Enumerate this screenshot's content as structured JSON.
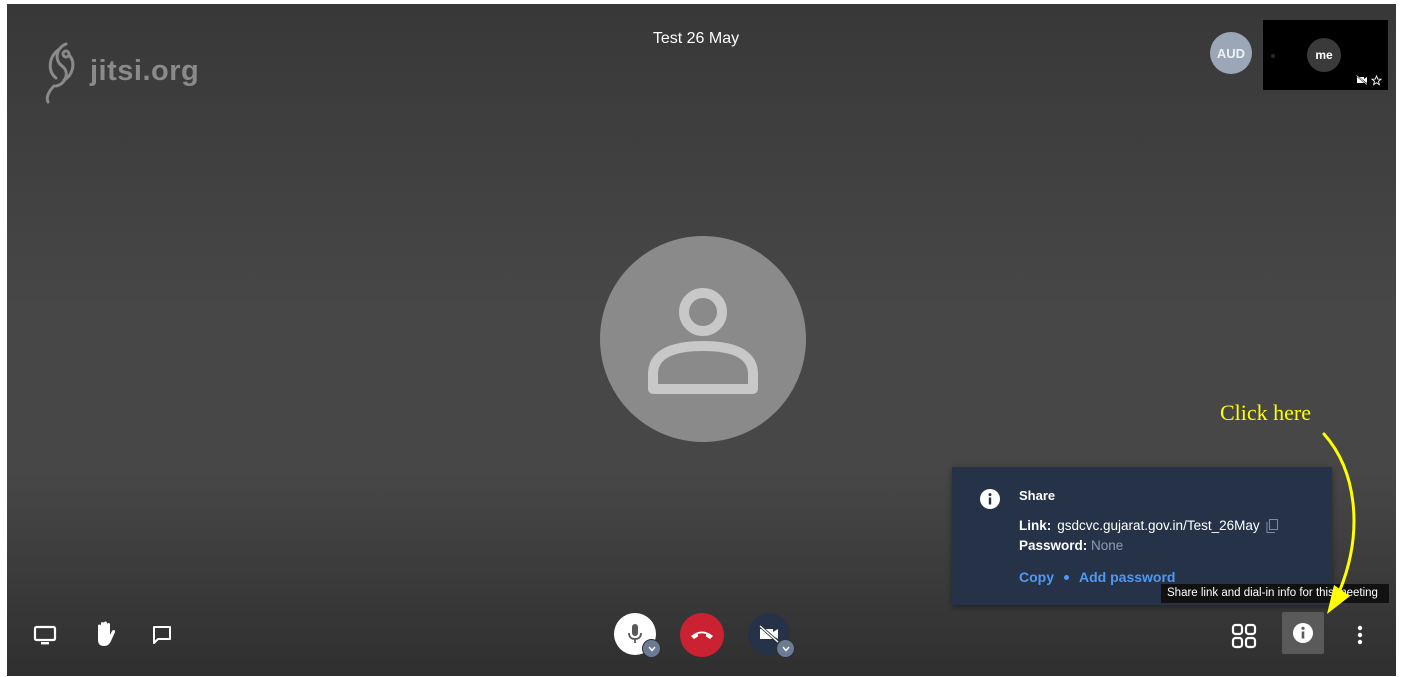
{
  "meeting": {
    "title": "Test 26 May"
  },
  "logo": {
    "text": "jitsi.org",
    "icon": "jitsi-watermark-icon"
  },
  "participants": {
    "remote_initials": "AUD",
    "self_initials": "me",
    "self_icons": [
      "camera-muted-icon",
      "star-icon"
    ]
  },
  "share_panel": {
    "title": "Share",
    "link_label": "Link:",
    "link_value": "gsdcvc.gujarat.gov.in/Test_26May",
    "password_label": "Password:",
    "password_value": "None",
    "copy_label": "Copy",
    "add_password_label": "Add password"
  },
  "tooltip": {
    "text": "Share link and dial-in info for this meeting"
  },
  "annotation": {
    "text": "Click here",
    "color": "#ffff00"
  },
  "toolbar": {
    "left": [
      "screen-share-icon",
      "raise-hand-icon",
      "chat-icon"
    ],
    "center": [
      "microphone-icon",
      "hangup-icon",
      "camera-muted-icon"
    ],
    "right": [
      "tile-view-icon",
      "info-icon",
      "more-options-icon"
    ]
  },
  "colors": {
    "hangup": "#cb2232",
    "panel_bg": "#253247",
    "link_accent": "#4e9af2"
  }
}
